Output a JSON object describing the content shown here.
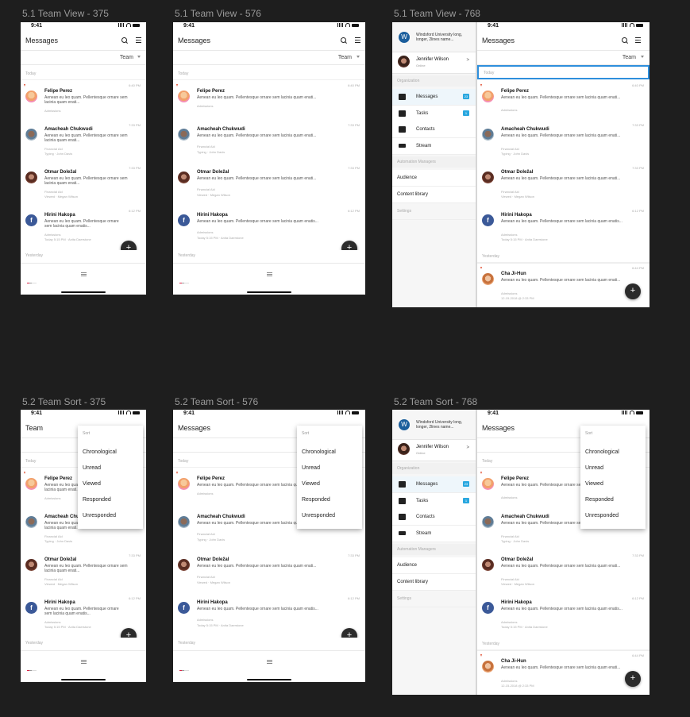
{
  "frames": [
    {
      "label": "5.1 Team View - 375"
    },
    {
      "label": "5.1 Team View - 576"
    },
    {
      "label": "5.1 Team View - 768"
    },
    {
      "label": "5.2 Team Sort - 375"
    },
    {
      "label": "5.2 Team Sort - 576"
    },
    {
      "label": "5.2 Team Sort - 768"
    }
  ],
  "status": {
    "time": "9:41"
  },
  "appbar": {
    "title_messages": "Messages",
    "title_team": "Team"
  },
  "team_selector": {
    "value": "Team"
  },
  "sections": {
    "today": "Today",
    "yesterday": "Yesterday"
  },
  "conversations": [
    {
      "name": "Felipe Perez",
      "preview": "Aenean eu leo quam. Pellentesque ornare sem lacinia quam enati...",
      "time": "6:40 PM",
      "meta1": "Admissions",
      "meta2": ""
    },
    {
      "name": "Amacheah Chukwudi",
      "preview": "Aenean eu leo quam. Pellentesque ornare sem lacinia quam enati...",
      "time": "7:33 PM",
      "meta1": "Financial Aid",
      "meta2": "Typing · John Davis"
    },
    {
      "name": "Otmar Doležal",
      "preview": "Aenean eu leo quam. Pellentesque ornare sem lacinia quam enati...",
      "time": "7:33 PM",
      "meta1": "Financial Aid",
      "meta2": "Viewed · Megan Wilson"
    },
    {
      "name": "Hirini Hakopa",
      "preview": "Aenean eu leo quam. Pellentesque ornare sem lacinia quam enatis...",
      "time": "6:12 PM",
      "meta1": "Admissions",
      "meta2": "Today 5:15 PM · Anita Daerstone"
    },
    {
      "name": "Cha Ji-Hun",
      "preview": "Aenean eu leo quam. Pellentesque ornare sem lacinia quam enati...",
      "time": "6:44 PM",
      "meta1": "Admissions",
      "meta2": "12-15-2018 @ 2:33 PM"
    }
  ],
  "fab": {
    "symbol": "+"
  },
  "drawer": {
    "university": "Windsford University long, longer, 2lines name...",
    "user_name": "Jennifer Wilson",
    "user_status": "Online",
    "chevron": ">",
    "organization": "Organization",
    "items": [
      {
        "label": "Messages",
        "badge": "23"
      },
      {
        "label": "Tasks",
        "badge": "1"
      },
      {
        "label": "Contacts",
        "badge": ""
      },
      {
        "label": "Stream",
        "badge": ""
      }
    ],
    "automation": "Automation Managers",
    "audience": "Audience",
    "content_library": "Content library",
    "settings": "Settings"
  },
  "sort_menu": {
    "header": "Sort",
    "options": [
      "Chronological",
      "Unread",
      "Viewed",
      "Responded",
      "Unresponded"
    ]
  },
  "colors": {
    "accent": "#29a7df",
    "fab": "#2b2b2b",
    "flag": "#e04b2f",
    "background": "#1e1e1e"
  }
}
